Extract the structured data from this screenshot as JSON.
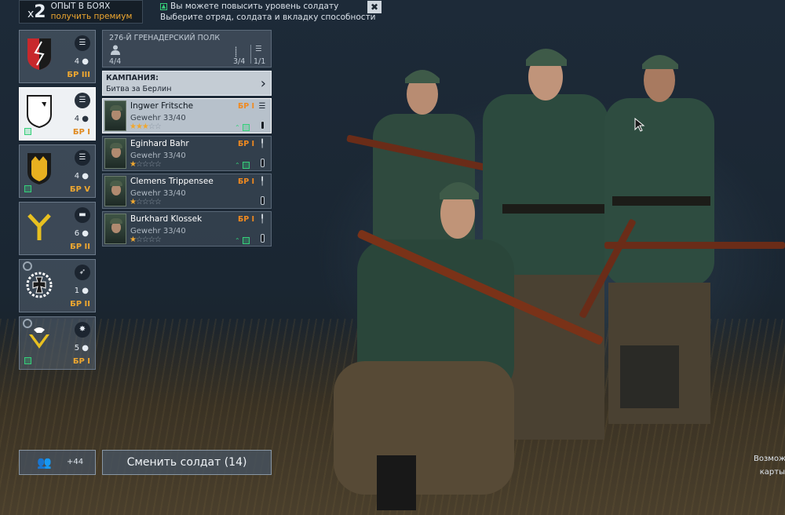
{
  "xp": {
    "multiplier": "2",
    "label": "ОПЫТ В БОЯХ",
    "premium_link": "получить премиум"
  },
  "notice": {
    "line1": "Вы можете повысить уровень солдату",
    "line2": "Выберите отряд, солдата и вкладку способности",
    "close": "✖"
  },
  "squads": [
    {
      "count": "4",
      "br": "БР III",
      "emblem": "red-black-shield",
      "type_icon": "list-icon"
    },
    {
      "count": "4",
      "br": "БР I",
      "emblem": "white-shield",
      "type_icon": "list-icon",
      "active": true
    },
    {
      "count": "4",
      "br": "БР V",
      "emblem": "yellow-shield",
      "type_icon": "list-icon"
    },
    {
      "count": "6",
      "br": "БР II",
      "emblem": "yellow-y",
      "type_icon": "vehicle-icon"
    },
    {
      "count": "1",
      "br": "БР II",
      "emblem": "iron-cross-wreath",
      "type_icon": "rocket-icon"
    },
    {
      "count": "5",
      "br": "БР I",
      "emblem": "eagle",
      "type_icon": "explosion-icon"
    }
  ],
  "regiment": {
    "title": "276-Й ГРЕНАДЕРСКИЙ ПОЛК",
    "capacity": "4/4",
    "weapons_stat": "3/4",
    "slots_stat": "1/1"
  },
  "campaign": {
    "label": "КАМПАНИЯ:",
    "value": "Битва за Берлин"
  },
  "soldiers": [
    {
      "name": "Ingwer Fritsche",
      "weapon": "Gewehr 33/40",
      "br": "БР I",
      "stars_on": "★★★",
      "stars_off": "☆☆",
      "selected": true
    },
    {
      "name": "Eginhard Bahr",
      "weapon": "Gewehr 33/40",
      "br": "БР I",
      "stars_on": "★",
      "stars_off": "☆☆☆☆"
    },
    {
      "name": "Clemens Trippensee",
      "weapon": "Gewehr 33/40",
      "br": "БР I",
      "stars_on": "★",
      "stars_off": "☆☆☆☆"
    },
    {
      "name": "Burkhard Klossek",
      "weapon": "Gewehr 33/40",
      "br": "БР I",
      "stars_on": "★",
      "stars_off": "☆☆☆☆"
    }
  ],
  "reserve": {
    "count": "+44"
  },
  "change_button": "Сменить солдат (14)",
  "side_hint": {
    "line1": "Возмож",
    "line2": "карты"
  },
  "colors": {
    "accent": "#f0a830",
    "boost": "#35d07a",
    "panel": "#465260"
  }
}
